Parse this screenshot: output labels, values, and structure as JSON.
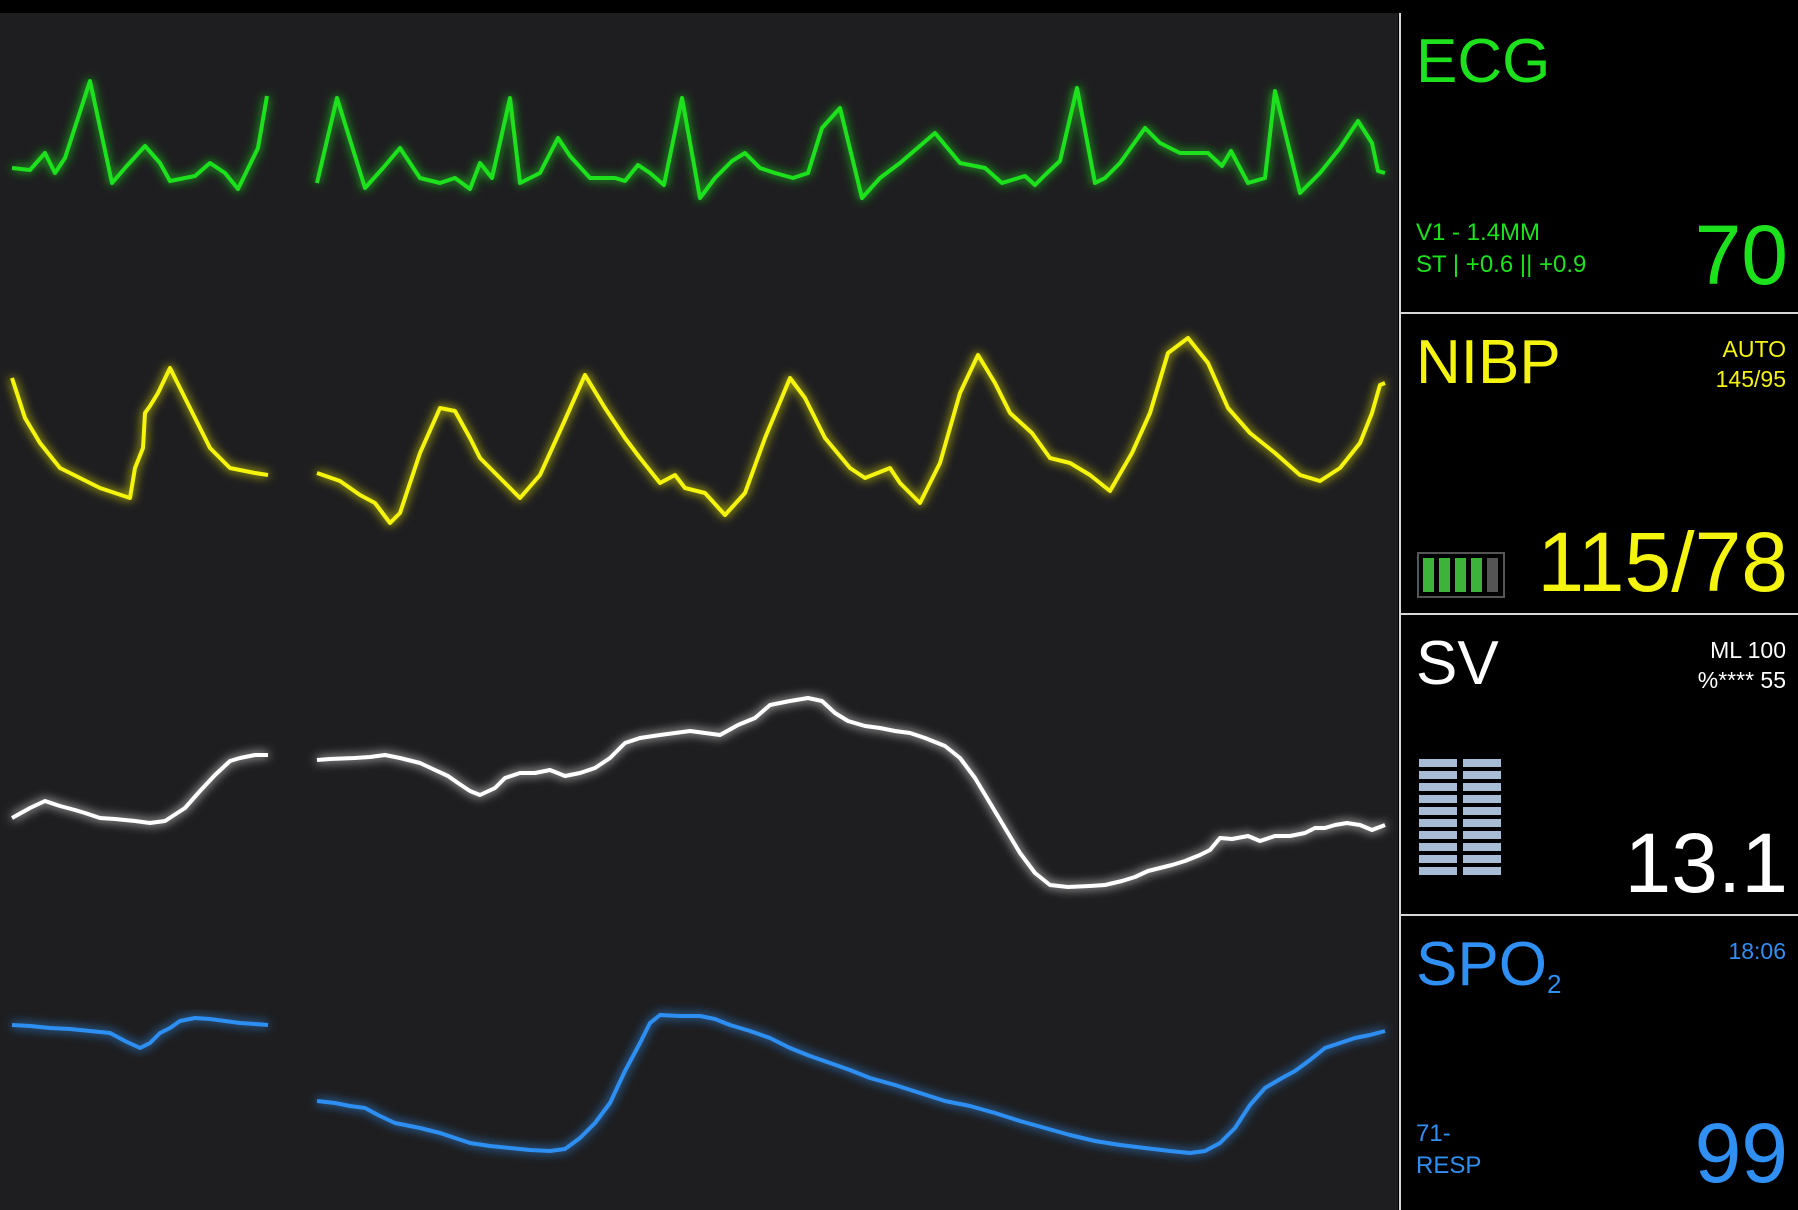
{
  "colors": {
    "ecg": "#1ce11c",
    "nibp": "#f4f40e",
    "sv": "#ffffff",
    "spo2": "#2f8ff2",
    "wave_bg": "#1e1e20",
    "divider": "#d8d8d8",
    "battery_fill": "#3cb43c",
    "battery_frame": "#555555",
    "bar_gauge": "#a9bcd6"
  },
  "ecg": {
    "label": "ECG",
    "lead": "V1 - 1.4MM",
    "st": "ST | +0.6 || +0.9",
    "value": "70"
  },
  "nibp": {
    "label": "NIBP",
    "mode": "AUTO",
    "last": "145/95",
    "value": "115/78",
    "icon": "battery-icon",
    "battery_level": 0.8
  },
  "sv": {
    "label": "SV",
    "line1": "ML 100",
    "line2": "%**** 55",
    "value": "13.1",
    "icon": "bar-gauge-icon"
  },
  "spo2": {
    "label": "SPO",
    "label_sub": "2",
    "time": "18:06",
    "resp_value": "71-",
    "resp_label": "RESP",
    "value": "99"
  },
  "waveforms": [
    "ecg",
    "nibp",
    "sv",
    "spo2"
  ]
}
